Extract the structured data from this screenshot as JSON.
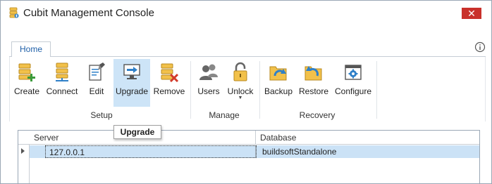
{
  "window": {
    "title": "Cubit Management Console",
    "close_label": "✕"
  },
  "tabs": [
    {
      "label": "Home"
    }
  ],
  "ribbon": {
    "groups": [
      {
        "label": "Setup"
      },
      {
        "label": "Manage"
      },
      {
        "label": "Recovery"
      }
    ],
    "buttons": {
      "create": "Create",
      "connect": "Connect",
      "edit": "Edit",
      "upgrade": "Upgrade",
      "remove": "Remove",
      "users": "Users",
      "unlock": "Unlock",
      "unlock_caret": "▼",
      "backup": "Backup",
      "restore": "Restore",
      "configure": "Configure"
    },
    "hovered": "upgrade"
  },
  "tooltip": {
    "text": "Upgrade"
  },
  "grid": {
    "columns": [
      "Server",
      "Database"
    ],
    "rows": [
      {
        "server": "127.0.0.1",
        "database": "buildsoftStandalone",
        "selected": true
      }
    ]
  },
  "icons": {
    "app": "app-database-icon",
    "help": "help-info-icon",
    "create": "database-add-icon",
    "connect": "database-connect-icon",
    "edit": "document-edit-icon",
    "upgrade": "monitor-upgrade-icon",
    "remove": "database-remove-icon",
    "users": "users-icon",
    "unlock": "padlock-icon",
    "backup": "folder-backup-icon",
    "restore": "folder-restore-icon",
    "configure": "configure-window-icon"
  },
  "colors": {
    "accent": "#1e5fa8",
    "close": "#c9312b",
    "hover": "#cde4f7",
    "selected_row": "#cbe2f6"
  }
}
